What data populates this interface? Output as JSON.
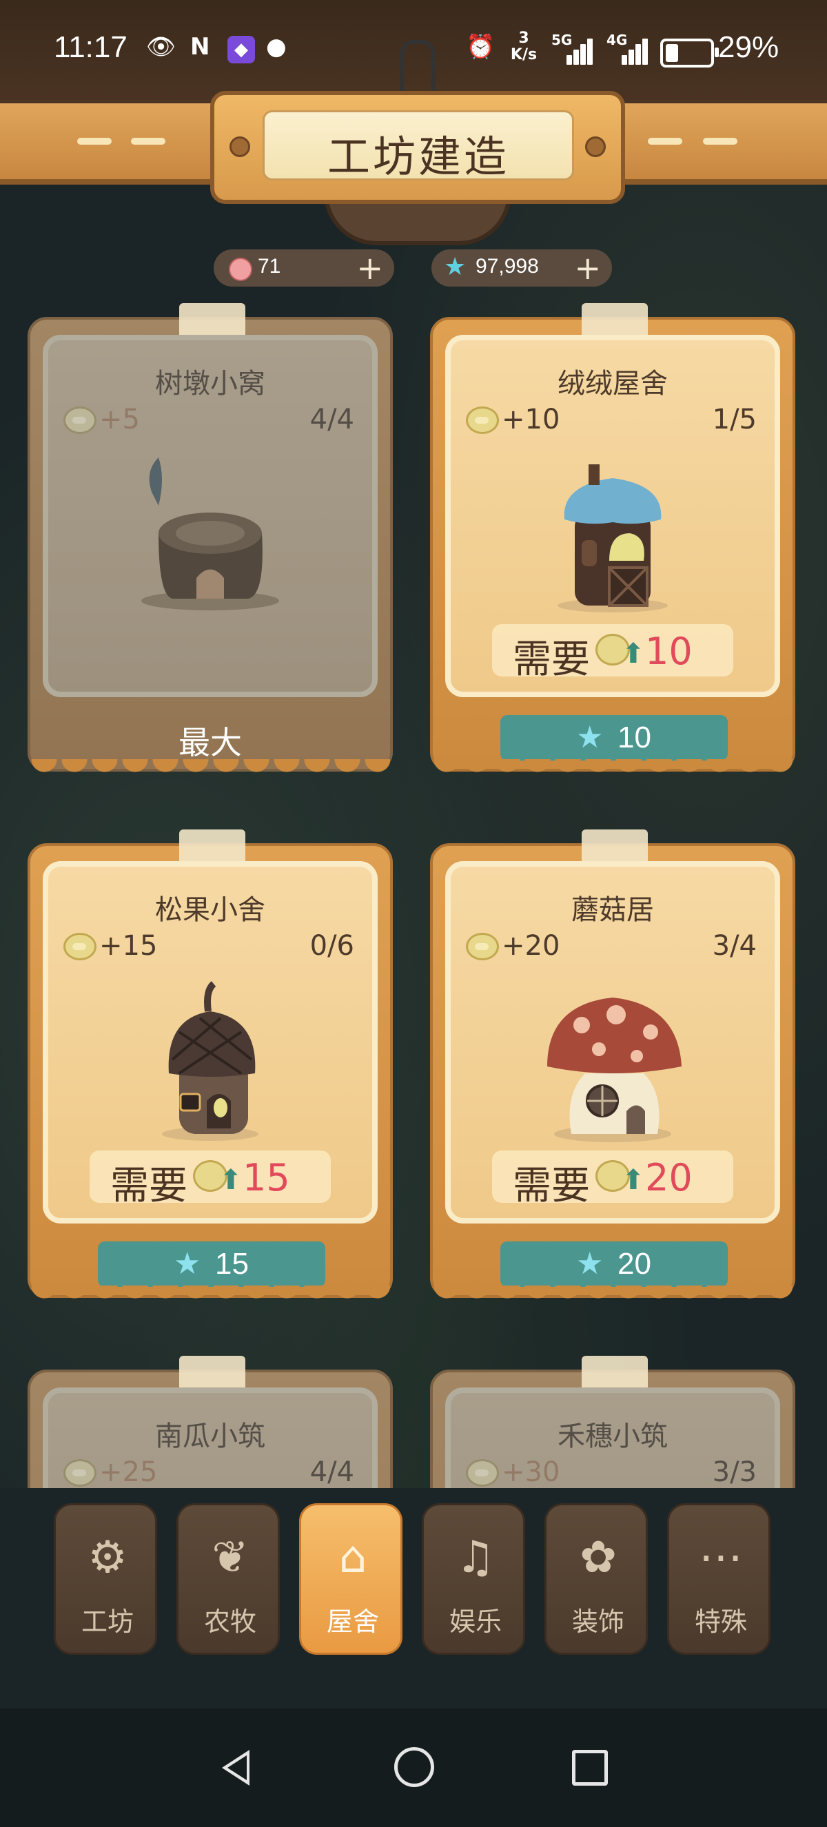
{
  "status_bar": {
    "time": "11:17",
    "net_speed_value": "3",
    "net_speed_unit": "K/s",
    "net_5g": "5G",
    "net_4g": "4G",
    "battery_text": "29%",
    "battery_level": 0.29
  },
  "header": {
    "title": "工坊建造"
  },
  "currency": {
    "coins": "71",
    "stars": "97,998",
    "plus": "+"
  },
  "cards": [
    {
      "name": "树墩小窝",
      "bonus": "+5",
      "count": "4/4",
      "need_label": "",
      "need_value": "",
      "price": "",
      "max_label": "最大",
      "art": "stump-house"
    },
    {
      "name": "绒绒屋舍",
      "bonus": "+10",
      "count": "1/5",
      "need_label": "需要",
      "need_value": "10",
      "price": "10",
      "max_label": "",
      "art": "blue-roof-house"
    },
    {
      "name": "松果小舍",
      "bonus": "+15",
      "count": "0/6",
      "need_label": "需要",
      "need_value": "15",
      "price": "15",
      "max_label": "",
      "art": "acorn-house"
    },
    {
      "name": "蘑菇居",
      "bonus": "+20",
      "count": "3/4",
      "need_label": "需要",
      "need_value": "20",
      "price": "20",
      "max_label": "",
      "art": "mushroom-house"
    },
    {
      "name": "南瓜小筑",
      "bonus": "+25",
      "count": "4/4",
      "art": "pumpkin-house"
    },
    {
      "name": "禾穗小筑",
      "bonus": "+30",
      "count": "3/3",
      "art": "wheat-house"
    }
  ],
  "bottom_nav": [
    {
      "label": "工坊",
      "icon": "workshop-gear-icon",
      "active": false
    },
    {
      "label": "农牧",
      "icon": "sprout-icon",
      "active": false
    },
    {
      "label": "屋舍",
      "icon": "mushroom-house-icon",
      "active": true
    },
    {
      "label": "娱乐",
      "icon": "bell-icon",
      "active": false
    },
    {
      "label": "装饰",
      "icon": "flower-icon",
      "active": false
    },
    {
      "label": "特殊",
      "icon": "more-dots-icon",
      "active": false
    }
  ],
  "colors": {
    "accent": "#e99a42",
    "price_button": "#4c9690",
    "need_value": "#e04a5a"
  }
}
